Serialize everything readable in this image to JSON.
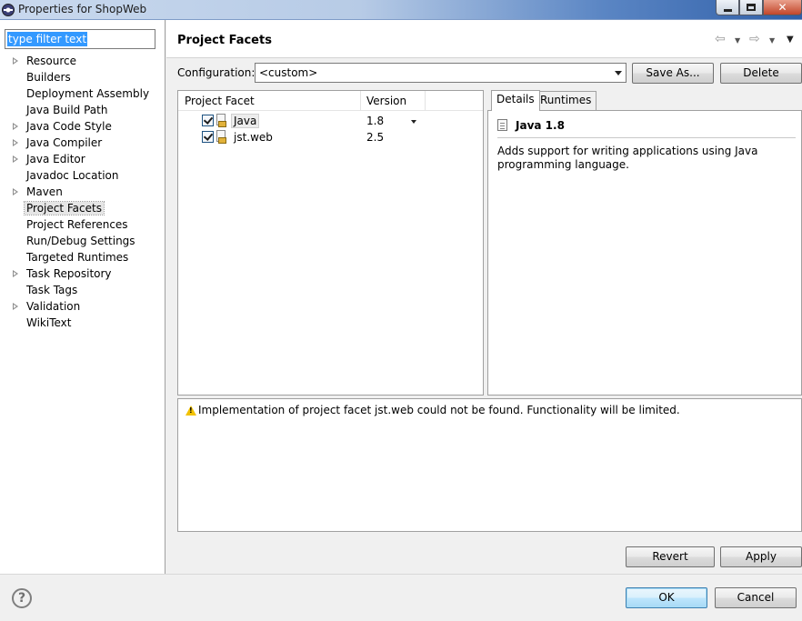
{
  "window": {
    "title": "Properties for ShopWeb",
    "controls": {
      "minimize": "min",
      "maximize": "max",
      "close": "✕"
    }
  },
  "filter": {
    "value": "type filter text"
  },
  "tree": {
    "items": [
      {
        "label": "Resource",
        "expandable": true
      },
      {
        "label": "Builders",
        "expandable": false
      },
      {
        "label": "Deployment Assembly",
        "expandable": false
      },
      {
        "label": "Java Build Path",
        "expandable": false
      },
      {
        "label": "Java Code Style",
        "expandable": true
      },
      {
        "label": "Java Compiler",
        "expandable": true
      },
      {
        "label": "Java Editor",
        "expandable": true
      },
      {
        "label": "Javadoc Location",
        "expandable": false
      },
      {
        "label": "Maven",
        "expandable": true
      },
      {
        "label": "Project Facets",
        "expandable": false,
        "selected": true
      },
      {
        "label": "Project References",
        "expandable": false
      },
      {
        "label": "Run/Debug Settings",
        "expandable": false
      },
      {
        "label": "Targeted Runtimes",
        "expandable": false
      },
      {
        "label": "Task Repository",
        "expandable": true
      },
      {
        "label": "Task Tags",
        "expandable": false
      },
      {
        "label": "Validation",
        "expandable": true
      },
      {
        "label": "WikiText",
        "expandable": false
      }
    ]
  },
  "page": {
    "title": "Project Facets",
    "nav": {
      "back": "⇦",
      "forward": "⇨",
      "dropdown": "▼",
      "menu": "▼"
    }
  },
  "configuration": {
    "label": "Configuration:",
    "value": "<custom>",
    "save_as": "Save As...",
    "delete": "Delete"
  },
  "facets": {
    "headers": [
      "Project Facet",
      "Version"
    ],
    "rows": [
      {
        "name": "Java",
        "version": "1.8",
        "checked": true,
        "selected": true
      },
      {
        "name": "jst.web",
        "version": "2.5",
        "checked": true,
        "selected": false
      }
    ]
  },
  "details": {
    "tabs": [
      "Details",
      "Runtimes"
    ],
    "active_tab": "Details",
    "title": "Java 1.8",
    "description": "Adds support for writing applications using Java programming language."
  },
  "problems": {
    "message": "Implementation of project facet jst.web could not be found. Functionality will be limited."
  },
  "buttons": {
    "revert": "Revert",
    "apply": "Apply",
    "ok": "OK",
    "cancel": "Cancel",
    "help": "?"
  }
}
